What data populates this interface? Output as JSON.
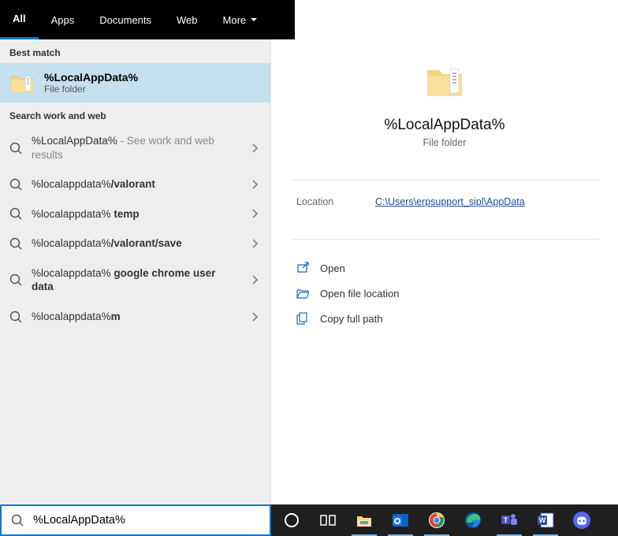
{
  "tabs": [
    "All",
    "Apps",
    "Documents",
    "Web",
    "More"
  ],
  "activeTab": 0,
  "sections": {
    "best_match_label": "Best match",
    "search_web_label": "Search work and web"
  },
  "bestMatch": {
    "title": "%LocalAppData%",
    "subtitle": "File folder"
  },
  "suggestions": [
    {
      "prefix": "%LocalAppData%",
      "bold": "",
      "suffix": " - See work and web results",
      "suffixGray": true
    },
    {
      "prefix": "%localappdata%",
      "bold": "/valorant",
      "suffix": ""
    },
    {
      "prefix": "%localappdata% ",
      "bold": "temp",
      "suffix": ""
    },
    {
      "prefix": "%localappdata%",
      "bold": "/valorant/save",
      "suffix": ""
    },
    {
      "prefix": "%localappdata% ",
      "bold": "google chrome user data",
      "suffix": ""
    },
    {
      "prefix": "%localappdata%",
      "bold": "m",
      "suffix": ""
    }
  ],
  "preview": {
    "title": "%LocalAppData%",
    "subtitle": "File folder",
    "location_label": "Location",
    "location_value": "C:\\Users\\erpsupport_sipl\\AppData"
  },
  "actions": [
    {
      "icon": "open",
      "label": "Open"
    },
    {
      "icon": "folder-open",
      "label": "Open file location"
    },
    {
      "icon": "copy",
      "label": "Copy full path"
    }
  ],
  "search": {
    "value": "%LocalAppData%"
  },
  "taskbar": [
    {
      "name": "cortana",
      "active": false
    },
    {
      "name": "task-view",
      "active": false
    },
    {
      "name": "file-explorer",
      "active": true
    },
    {
      "name": "outlook",
      "active": true
    },
    {
      "name": "chrome",
      "active": true
    },
    {
      "name": "edge",
      "active": false
    },
    {
      "name": "teams",
      "active": true
    },
    {
      "name": "word",
      "active": true
    },
    {
      "name": "discord",
      "active": false
    }
  ]
}
